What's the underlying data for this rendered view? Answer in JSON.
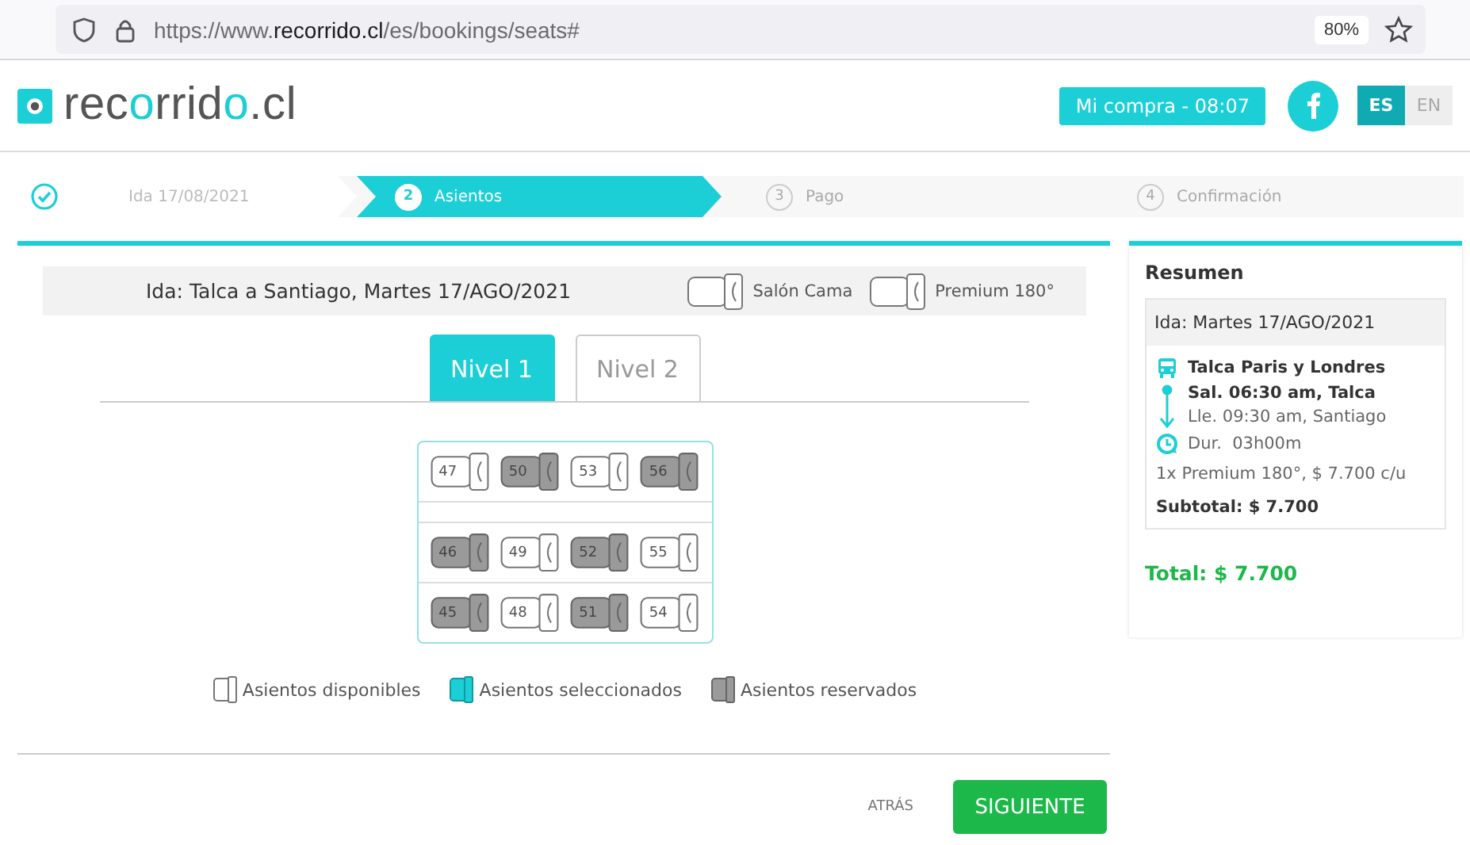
{
  "browser": {
    "url": "https://www.**recorrido.cl**/es/bookings/seats#",
    "zoom": "80%"
  },
  "header": {
    "logo": [
      {
        "text": "rec",
        "accent": false
      },
      {
        "text": "o",
        "accent": true
      },
      {
        "text": "rrid",
        "accent": false
      },
      {
        "text": "o",
        "accent": true
      },
      {
        "text": ".cl",
        "accent": false
      }
    ],
    "cart": "Mi compra - 08:07",
    "languages": [
      {
        "label": "ES",
        "selected": true
      },
      {
        "label": "EN",
        "selected": false
      }
    ]
  },
  "steps": [
    {
      "label": "Ida 17/08/2021",
      "completed": true,
      "selected": false
    },
    {
      "number": "2",
      "label": "Asientos",
      "completed": false,
      "selected": true
    },
    {
      "number": "3",
      "label": "Pago",
      "completed": false,
      "selected": false
    },
    {
      "number": "4",
      "label": "Confirmación",
      "completed": false,
      "selected": false
    }
  ],
  "trip": {
    "title": "Ida: Talca a Santiago, Martes 17/AGO/2021",
    "seat_types": [
      "Salón Cama",
      "Premium 180°"
    ]
  },
  "levels": [
    {
      "label": "Nivel 1",
      "selected": true
    },
    {
      "label": "Nivel 2",
      "selected": false
    }
  ],
  "seat_rows": [
    [
      {
        "number": "47",
        "reserved": false
      },
      {
        "number": "50",
        "reserved": true
      },
      {
        "number": "53",
        "reserved": false
      },
      {
        "number": "56",
        "reserved": true
      }
    ],
    [],
    [
      {
        "number": "46",
        "reserved": true
      },
      {
        "number": "49",
        "reserved": false
      },
      {
        "number": "52",
        "reserved": true
      },
      {
        "number": "55",
        "reserved": false
      }
    ],
    [
      {
        "number": "45",
        "reserved": true
      },
      {
        "number": "48",
        "reserved": false
      },
      {
        "number": "51",
        "reserved": true
      },
      {
        "number": "54",
        "reserved": false
      }
    ]
  ],
  "legend": [
    {
      "label": "Asientos disponibles",
      "kind": "available"
    },
    {
      "label": "Asientos seleccionados",
      "kind": "selected"
    },
    {
      "label": "Asientos reservados",
      "kind": "reserved"
    }
  ],
  "summary": {
    "title": "Resumen",
    "date": "Ida: Martes 17/AGO/2021",
    "company": "Talca Paris y Londres",
    "departure": "Sal. 06:30 am, Talca",
    "arrival": "Lle. 09:30 am, Santiago",
    "duration": "Dur.  03h00m",
    "fare": "1x Premium 180°, $ 7.700 c/u",
    "subtotal": "Subtotal: $ 7.700",
    "total": "Total: $ 7.700"
  },
  "footer": {
    "back": "ATRÁS",
    "next": "SIGUIENTE"
  }
}
